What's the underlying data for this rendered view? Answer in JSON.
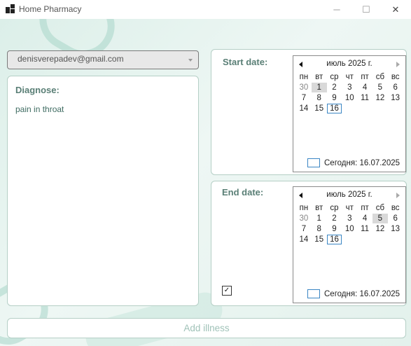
{
  "window": {
    "title": "Home Pharmacy",
    "minimize": "─",
    "maximize": "☐",
    "close": "✕"
  },
  "user": {
    "email": "denisverepadev@gmail.com"
  },
  "diagnose": {
    "label": "Diagnose:",
    "text": "pain in throat"
  },
  "start_date": {
    "label": "Start date:",
    "calendar": {
      "month": "июль 2025 г.",
      "weekdays": [
        "пн",
        "вт",
        "ср",
        "чт",
        "пт",
        "сб",
        "вс"
      ],
      "days": [
        "30",
        "1",
        "2",
        "3",
        "4",
        "5",
        "6",
        "7",
        "8",
        "9",
        "10",
        "11",
        "12",
        "13",
        "14",
        "15",
        "16"
      ],
      "selected": "1",
      "today": "16",
      "today_label": "Сегодня: 16.07.2025"
    }
  },
  "end_date": {
    "label": "End date:",
    "checked": true,
    "check_mark": "✓",
    "calendar": {
      "month": "июль 2025 г.",
      "weekdays": [
        "пн",
        "вт",
        "ср",
        "чт",
        "пт",
        "сб",
        "вс"
      ],
      "days": [
        "30",
        "1",
        "2",
        "3",
        "4",
        "5",
        "6",
        "7",
        "8",
        "9",
        "10",
        "11",
        "12",
        "13",
        "14",
        "15",
        "16"
      ],
      "selected": "5",
      "today": "16",
      "today_label": "Сегодня: 16.07.2025"
    }
  },
  "actions": {
    "add_illness": "Add illness"
  }
}
